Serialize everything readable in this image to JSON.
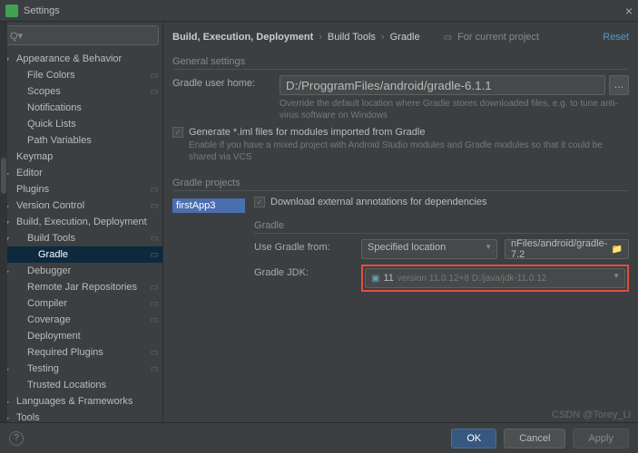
{
  "titlebar": {
    "title": "Settings"
  },
  "search": {
    "placeholder": "Q▾"
  },
  "sidebar": {
    "items": [
      {
        "label": "Appearance & Behavior",
        "indent": 0,
        "arrow": "down",
        "cog": false
      },
      {
        "label": "File Colors",
        "indent": 1,
        "arrow": "",
        "cog": true
      },
      {
        "label": "Scopes",
        "indent": 1,
        "arrow": "",
        "cog": true
      },
      {
        "label": "Notifications",
        "indent": 1,
        "arrow": "",
        "cog": false
      },
      {
        "label": "Quick Lists",
        "indent": 1,
        "arrow": "",
        "cog": false
      },
      {
        "label": "Path Variables",
        "indent": 1,
        "arrow": "",
        "cog": false
      },
      {
        "label": "Keymap",
        "indent": 0,
        "arrow": "",
        "cog": false
      },
      {
        "label": "Editor",
        "indent": 0,
        "arrow": "right",
        "cog": false
      },
      {
        "label": "Plugins",
        "indent": 0,
        "arrow": "",
        "cog": true
      },
      {
        "label": "Version Control",
        "indent": 0,
        "arrow": "right",
        "cog": true
      },
      {
        "label": "Build, Execution, Deployment",
        "indent": 0,
        "arrow": "down",
        "cog": false
      },
      {
        "label": "Build Tools",
        "indent": 1,
        "arrow": "down",
        "cog": true
      },
      {
        "label": "Gradle",
        "indent": 2,
        "arrow": "",
        "cog": true,
        "sel": true
      },
      {
        "label": "Debugger",
        "indent": 1,
        "arrow": "right",
        "cog": false
      },
      {
        "label": "Remote Jar Repositories",
        "indent": 1,
        "arrow": "",
        "cog": true
      },
      {
        "label": "Compiler",
        "indent": 1,
        "arrow": "",
        "cog": true
      },
      {
        "label": "Coverage",
        "indent": 1,
        "arrow": "",
        "cog": true
      },
      {
        "label": "Deployment",
        "indent": 1,
        "arrow": "",
        "cog": false
      },
      {
        "label": "Required Plugins",
        "indent": 1,
        "arrow": "",
        "cog": true
      },
      {
        "label": "Testing",
        "indent": 1,
        "arrow": "right",
        "cog": true
      },
      {
        "label": "Trusted Locations",
        "indent": 1,
        "arrow": "",
        "cog": false
      },
      {
        "label": "Languages & Frameworks",
        "indent": 0,
        "arrow": "right",
        "cog": false
      },
      {
        "label": "Tools",
        "indent": 0,
        "arrow": "right",
        "cog": false
      }
    ]
  },
  "crumbs": {
    "a": "Build, Execution, Deployment",
    "b": "Build Tools",
    "c": "Gradle",
    "proj": "For current project",
    "reset": "Reset"
  },
  "general": {
    "title": "General settings",
    "home_lbl": "Gradle user home:",
    "home_val": "D:/ProggramFiles/android/gradle-6.1.1",
    "home_help": "Override the default location where Gradle stores downloaded files, e.g. to tune anti-virus software on Windows",
    "iml_lbl": "Generate *.iml files for modules imported from Gradle",
    "iml_help": "Enable if you have a mixed project with Android Studio modules and Gradle modules so that it could be shared via VCS"
  },
  "projects": {
    "title": "Gradle projects",
    "item": "firstApp3",
    "dl": "Download external annotations for dependencies",
    "gradle_title": "Gradle",
    "from_lbl": "Use Gradle from:",
    "from_val": "Specified location",
    "path": "nFiles/android/gradle-7.2",
    "jdk_lbl": "Gradle JDK:",
    "jdk_main": "11",
    "jdk_sub": "version 11.0.12+8 D:/java/jdk-11.0.12"
  },
  "footer": {
    "ok": "OK",
    "cancel": "Cancel",
    "apply": "Apply"
  },
  "watermark": "CSDN @Torey_Li"
}
